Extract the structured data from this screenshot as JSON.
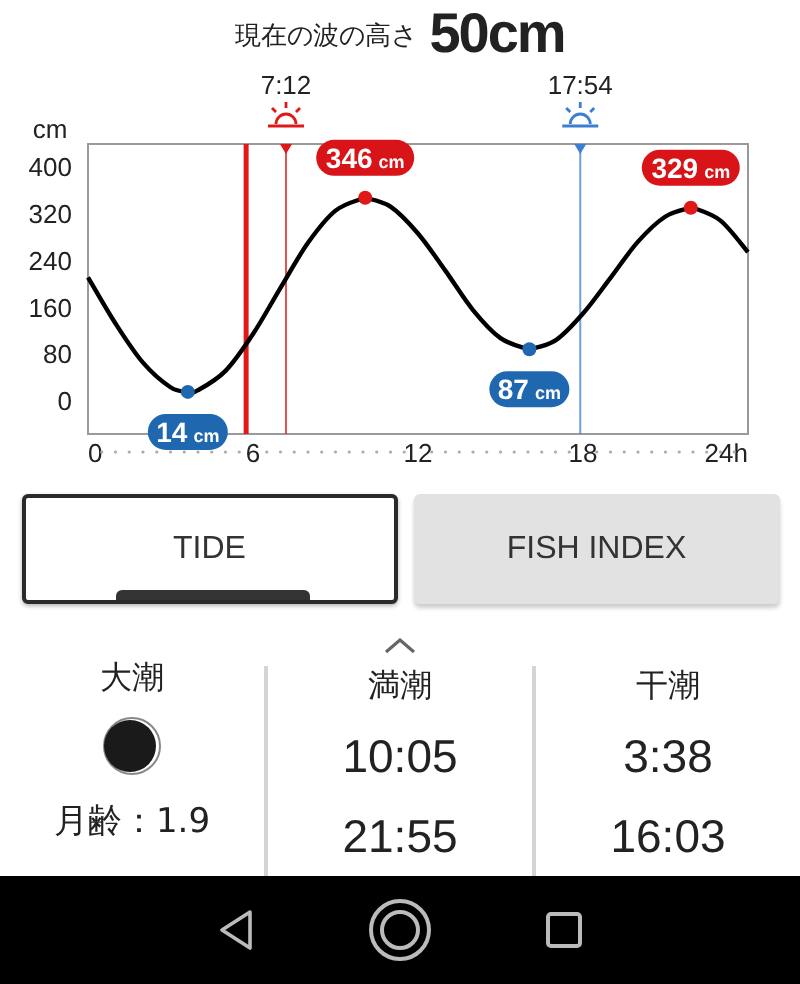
{
  "header": {
    "label": "現在の波の高さ",
    "value": "50cm"
  },
  "chart": {
    "chart_data": {
      "type": "line",
      "ylabel": "cm",
      "x": [
        0,
        1,
        2,
        3,
        3.63,
        4,
        5,
        6,
        7,
        8,
        9,
        10,
        10.08,
        11,
        12,
        13,
        14,
        15,
        16,
        16.05,
        17,
        18,
        19,
        20,
        21,
        21.92,
        22,
        23,
        24
      ],
      "values": [
        210,
        131,
        64,
        22,
        14,
        17,
        50,
        113,
        192,
        269,
        324,
        345,
        346,
        331,
        285,
        221,
        154,
        106,
        87,
        87,
        102,
        148,
        209,
        271,
        314,
        329,
        329,
        307,
        253
      ],
      "xlim": [
        0,
        24
      ],
      "ylim": [
        -58,
        438
      ],
      "xticks": [
        0,
        6,
        12,
        18,
        {
          "value": 24,
          "label": "24h"
        }
      ],
      "yticks": [
        0,
        80,
        160,
        240,
        320,
        400
      ],
      "ref_lines": [
        {
          "axis": "x",
          "value": 5.75,
          "color": "#e01818"
        },
        {
          "axis": "x",
          "value": 7.2,
          "color": "#e01818"
        },
        {
          "axis": "x",
          "value": 17.9,
          "color": "#3c7fd0"
        }
      ],
      "annotations": [
        {
          "x": 3.63,
          "y": 14,
          "text": "14 cm"
        },
        {
          "x": 10.08,
          "y": 346,
          "text": "346 cm"
        },
        {
          "x": 16.05,
          "y": 87,
          "text": "87 cm"
        },
        {
          "x": 21.92,
          "y": 329,
          "text": "329 cm"
        }
      ]
    },
    "sun_times": [
      "7:12",
      "17:54"
    ]
  },
  "tabs": [
    {
      "label": "TIDE",
      "selected": true
    },
    {
      "label": "FISH INDEX",
      "selected": false
    }
  ],
  "moon": {
    "title": "大潮",
    "age": "月齢：1.9"
  },
  "tide_columns": [
    {
      "title": "満潮",
      "times": [
        "10:05",
        "21:55"
      ]
    },
    {
      "title": "干潮",
      "times": [
        "3:38",
        "16:03"
      ]
    }
  ]
}
